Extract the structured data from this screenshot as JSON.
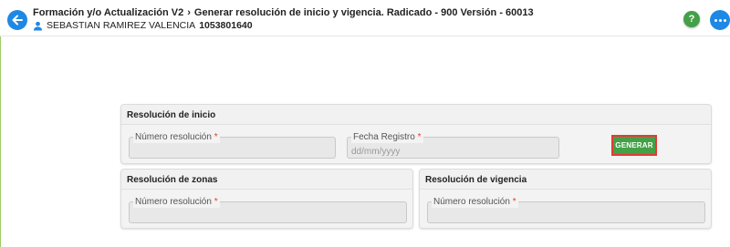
{
  "header": {
    "module_title": "Formación y/o Actualización V2",
    "page_title": "Generar resolución de inicio y vigencia. Radicado - 900 Versión - 60013",
    "user_name": "SEBASTIAN RAMIREZ VALENCIA",
    "user_id": "1053801640",
    "help_label": "?"
  },
  "sections": {
    "inicio": {
      "title": "Resolución de inicio",
      "numero_label": "Número resolución",
      "fecha_label": "Fecha Registro",
      "fecha_placeholder": "dd/mm/yyyy",
      "generate_label": "GENERAR"
    },
    "zonas": {
      "title": "Resolución de zonas",
      "numero_label": "Número resolución"
    },
    "vigencia": {
      "title": "Resolución de vigencia",
      "numero_label": "Número resolución"
    }
  },
  "required_marker": "*",
  "colors": {
    "primary": "#1e88e5",
    "success": "#43a047",
    "required": "#e53935"
  },
  "icons": {
    "back": "arrow-left-icon",
    "user": "person-icon",
    "help": "question-icon",
    "more": "more-horizontal-icon"
  }
}
